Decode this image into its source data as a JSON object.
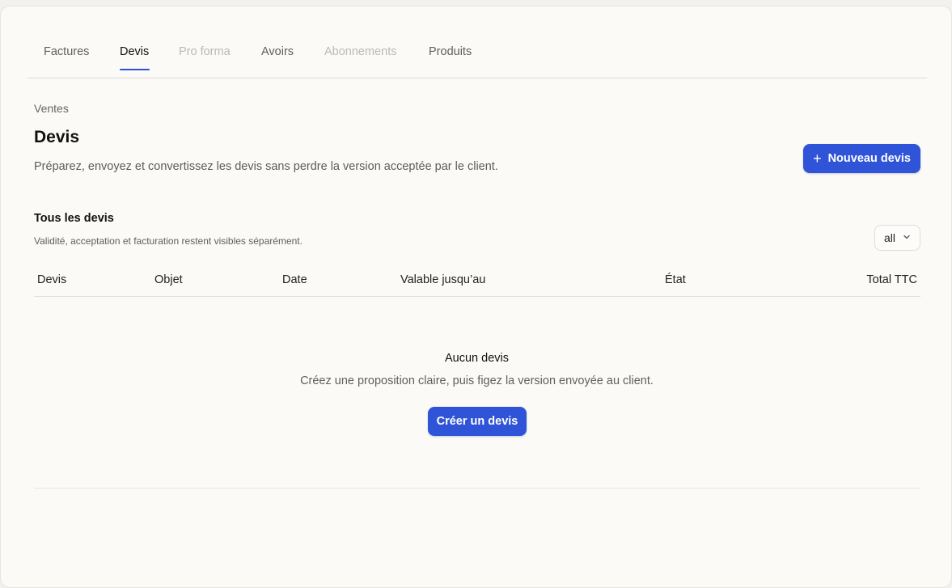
{
  "tabs": [
    {
      "label": "Factures",
      "state": "normal"
    },
    {
      "label": "Devis",
      "state": "active"
    },
    {
      "label": "Pro forma",
      "state": "disabled"
    },
    {
      "label": "Avoirs",
      "state": "normal"
    },
    {
      "label": "Abonnements",
      "state": "disabled"
    },
    {
      "label": "Produits",
      "state": "normal"
    }
  ],
  "header": {
    "eyebrow": "Ventes",
    "title": "Devis",
    "description": "Préparez, envoyez et convertissez les devis sans perdre la version acceptée par le client.",
    "new_button_label": "Nouveau devis"
  },
  "list": {
    "title": "Tous les devis",
    "subtitle": "Validité, acceptation et facturation restent visibles séparément.",
    "filter_value": "all",
    "columns": [
      "Devis",
      "Objet",
      "Date",
      "Valable jusqu’au",
      "État",
      "Total TTC"
    ]
  },
  "empty_state": {
    "title": "Aucun devis",
    "message": "Créez une proposition claire, puis figez la version envoyée au client.",
    "button_label": "Créer un devis"
  },
  "colors": {
    "accent": "#2f54d8",
    "background": "#fbfaf7"
  }
}
